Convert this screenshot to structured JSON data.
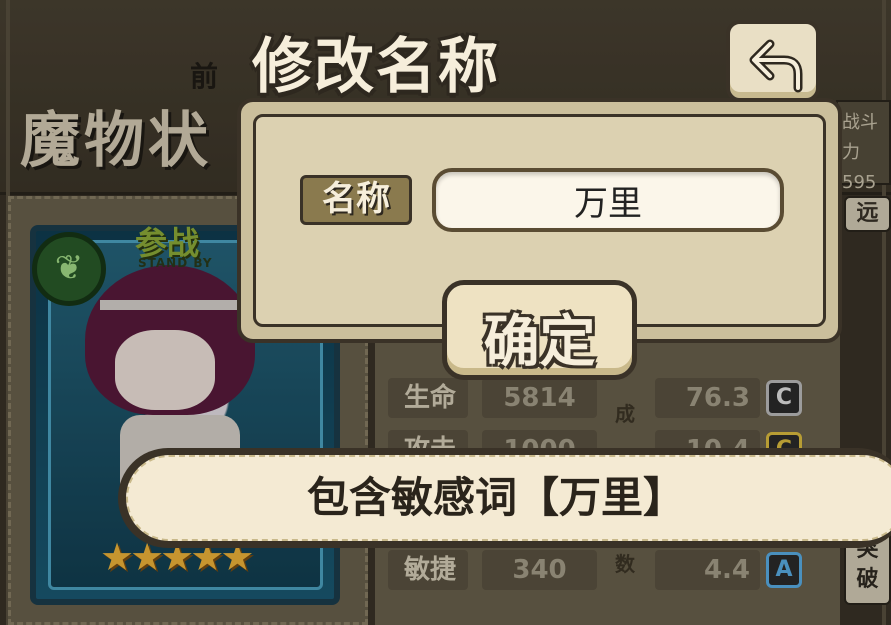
{
  "background": {
    "screen_title": "魔物状",
    "screen_subtitle": "前",
    "right_panel_lines": [
      "战斗力",
      "595"
    ],
    "far_tab": "远",
    "standby_label": "参战",
    "standby_sub": "STAND BY",
    "stats": [
      {
        "label": "生命",
        "value": "5814",
        "side_value": "76.3",
        "grade": "C"
      },
      {
        "label": "攻击",
        "value": "1000",
        "side_value": "10.4",
        "grade": "C"
      },
      {
        "label": "敏捷",
        "value": "340",
        "side_value": "4.4",
        "grade": "A"
      }
    ],
    "vertical_chars": [
      "成",
      "数"
    ],
    "breakthrough_label": [
      "突",
      "破"
    ],
    "star_count": 5
  },
  "dialog": {
    "title": "修改名称",
    "name_label": "名称",
    "name_value": "万里",
    "confirm_label": "确定",
    "back_icon": "back-arrow-icon"
  },
  "toast": {
    "message": "包含敏感词【万里】"
  }
}
